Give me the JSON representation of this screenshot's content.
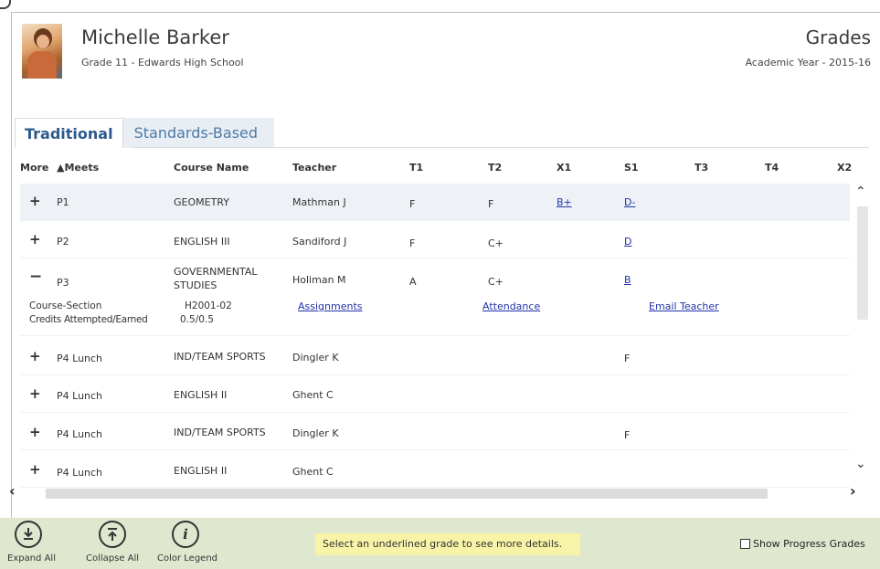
{
  "student": {
    "name": "Michelle Barker",
    "subtitle": "Grade 11 - Edwards High School"
  },
  "page": {
    "title": "Grades",
    "academic_year": "Academic Year - 2015-16"
  },
  "tabs": [
    {
      "label": "Traditional",
      "active": true
    },
    {
      "label": "Standards-Based",
      "active": false
    }
  ],
  "columns": {
    "more": "More",
    "meets": "▲Meets",
    "course": "Course Name",
    "teacher": "Teacher",
    "t1": "T1",
    "t2": "T2",
    "x1": "X1",
    "s1": "S1",
    "t3": "T3",
    "t4": "T4",
    "x2": "X2"
  },
  "rows": [
    {
      "expander": "+",
      "meets": "P1",
      "course": "GEOMETRY",
      "teacher": "Mathman J",
      "t1": "F",
      "t2": "F",
      "x1": "B+",
      "s1": "D-"
    },
    {
      "expander": "+",
      "meets": "P2",
      "course": "ENGLISH III",
      "teacher": "Sandiford J",
      "t1": "F",
      "t2": "C+",
      "x1": "",
      "s1": "D"
    },
    {
      "expander": "−",
      "meets": "P3",
      "course_line1": "GOVERNMENTAL",
      "course_line2": "STUDIES",
      "teacher": "Holiman M",
      "t1": "A",
      "t2": "C+",
      "x1": "",
      "s1": "B"
    },
    {
      "expander": "+",
      "meets": "P4 Lunch",
      "course": "IND/TEAM SPORTS",
      "teacher": "Dingler K",
      "t1": "",
      "t2": "",
      "x1": "",
      "s1": "F"
    },
    {
      "expander": "+",
      "meets": "P4 Lunch",
      "course": "ENGLISH II",
      "teacher": "Ghent C",
      "t1": "",
      "t2": "",
      "x1": "",
      "s1": ""
    },
    {
      "expander": "+",
      "meets": "P4 Lunch",
      "course": "IND/TEAM SPORTS",
      "teacher": "Dingler K",
      "t1": "",
      "t2": "",
      "x1": "",
      "s1": "F"
    },
    {
      "expander": "+",
      "meets": "P4 Lunch",
      "course": "ENGLISH II",
      "teacher": "Ghent C",
      "t1": "",
      "t2": "",
      "x1": "",
      "s1": ""
    }
  ],
  "details": {
    "course_section_label": "Course-Section",
    "course_section_value": "H2001-02",
    "credits_label": "Credits Attempted/Earned",
    "credits_value": "0.5/0.5",
    "assignments": "Assignments",
    "attendance": "Attendance",
    "email_teacher": "Email Teacher"
  },
  "footer": {
    "expand_all": "Expand All",
    "collapse_all": "Collapse All",
    "color_legend": "Color Legend",
    "hint": "Select an underlined grade to see more details.",
    "show_progress": "Show Progress Grades"
  },
  "colors": {
    "tab_active": "#2d5a8c",
    "link": "#2233aa",
    "footer_bg": "#dfe8cf",
    "hint_bg": "#f7f4a8"
  }
}
